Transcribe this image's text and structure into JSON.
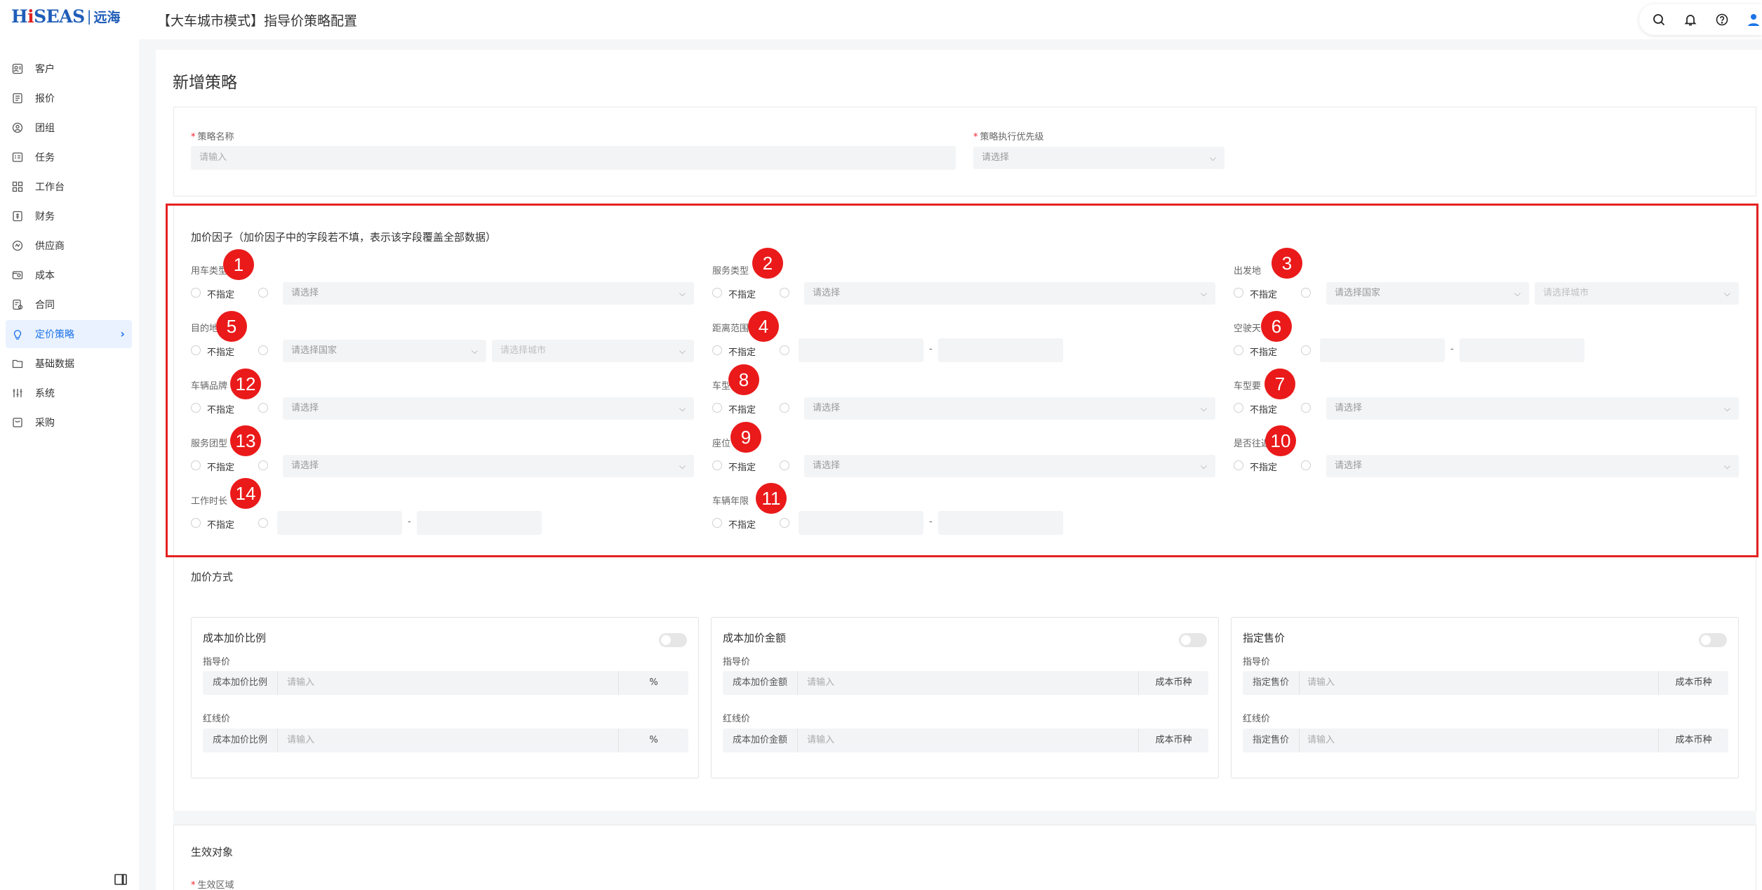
{
  "brand": {
    "logo_a": "H",
    "logo_i": "i",
    "logo_b": "SEAS",
    "logo_sep": "|",
    "logo_cn": "远海"
  },
  "header": {
    "title": "【大车城市模式】指导价策略配置"
  },
  "sidebar": {
    "items": [
      {
        "label": "客户",
        "icon": "customer-icon"
      },
      {
        "label": "报价",
        "icon": "quote-icon"
      },
      {
        "label": "团组",
        "icon": "group-icon"
      },
      {
        "label": "任务",
        "icon": "task-icon"
      },
      {
        "label": "工作台",
        "icon": "workbench-icon"
      },
      {
        "label": "财务",
        "icon": "finance-icon"
      },
      {
        "label": "供应商",
        "icon": "supplier-icon"
      },
      {
        "label": "成本",
        "icon": "cost-icon"
      },
      {
        "label": "合同",
        "icon": "contract-icon"
      },
      {
        "label": "定价策略",
        "icon": "pricing-icon",
        "active": true
      },
      {
        "label": "基础数据",
        "icon": "data-icon"
      },
      {
        "label": "系统",
        "icon": "system-icon"
      },
      {
        "label": "采购",
        "icon": "purchase-icon"
      }
    ]
  },
  "page": {
    "title": "新增策略"
  },
  "basic": {
    "name_label": "策略名称",
    "name_placeholder": "请输入",
    "priority_label": "策略执行优先级",
    "priority_placeholder": "请选择"
  },
  "factors": {
    "title": "加价因子（加价因子中的字段若不填，表示该字段覆盖全部数据）",
    "unspecified": "不指定",
    "select_placeholder": "请选择",
    "country_placeholder": "请选择国家",
    "city_placeholder": "请选择城市",
    "dash": "-",
    "f_car_type": "用车类型",
    "f_service_type": "服务类型",
    "f_origin": "出发地",
    "f_destination": "目的地",
    "f_distance": "距离范围",
    "f_empty_days": "空驶天",
    "f_brand": "车辆品牌",
    "f_model": "车型",
    "f_model_req": "车型要",
    "f_service_group": "服务团型",
    "f_seats": "座位",
    "f_roundtrip": "是否往返",
    "f_work_hours": "工作时长",
    "f_vehicle_age": "车辆年限"
  },
  "badges": [
    "1",
    "2",
    "3",
    "4",
    "5",
    "6",
    "7",
    "8",
    "9",
    "10",
    "11",
    "12",
    "13",
    "14"
  ],
  "markup": {
    "title": "加价方式",
    "guide_label": "指导价",
    "redline_label": "红线价",
    "placeholder": "请输入",
    "cards": [
      {
        "title": "成本加价比例",
        "prefix": "成本加价比例",
        "suffix": "%"
      },
      {
        "title": "成本加价金额",
        "prefix": "成本加价金额",
        "suffix": "成本币种"
      },
      {
        "title": "指定售价",
        "prefix": "指定售价",
        "suffix": "成本币种"
      }
    ]
  },
  "effect": {
    "title": "生效对象",
    "region_label": "生效区域"
  },
  "colors": {
    "accent": "#1a73e8",
    "highlight": "#e52222",
    "badge": "#ea1a1a"
  }
}
